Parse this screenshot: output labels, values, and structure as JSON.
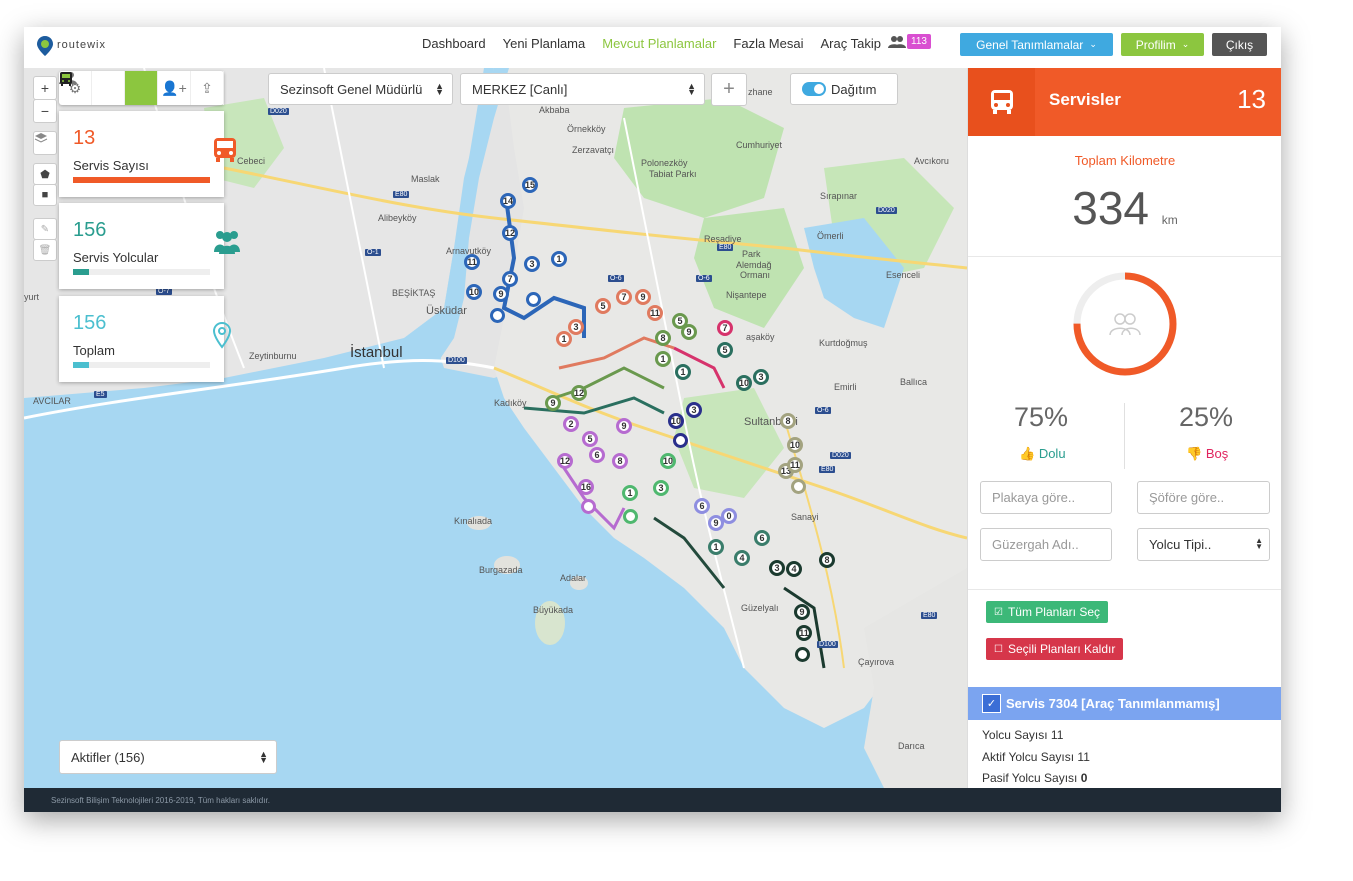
{
  "app": {
    "logo_text": "routewix"
  },
  "nav": {
    "items": [
      "Dashboard",
      "Yeni Planlama",
      "Mevcut Planlamalar",
      "Fazla Mesai",
      "Araç Takip"
    ],
    "active_index": 2,
    "users_badge": "113",
    "genel_label": "Genel Tanımlamalar",
    "profil_label": "Profilim",
    "cikis_label": "Çıkış"
  },
  "colors": {
    "accent": "#f05a28",
    "green": "#8cc63f",
    "teal": "#2a9d8f",
    "cyan": "#4bbfcf",
    "blue_btn": "#3fa9e0",
    "dark_btn": "#555555",
    "badge": "#d94fd1"
  },
  "map": {
    "company_select": "Sezinsoft Genel Müdürlü",
    "location_select": "MERKEZ [Canlı]",
    "toggle_label": "Dağıtım",
    "filter_select": "Aktifler (156)",
    "labels": {
      "maslak": "Maslak",
      "cebeci": "Cebeci",
      "alibeykoy": "Alibeyköy",
      "arnavutkoy": "Arnavutköy",
      "besiktas": "BEŞİKTAŞ",
      "uskudar": "Üsküdar",
      "istanbul": "İstanbul",
      "zeytinburnu": "Zeytinburnu",
      "avcilar": "AVCILAR",
      "yurt": "yurt",
      "akbaba": "Akbaba",
      "omerkoy": "Örnekköy",
      "zerzavatci": "Zerzavatçı",
      "polonezkoy": "Polonezköy",
      "tabiat": "Tabiat Parkı",
      "cumhuriyet": "Cumhuriyet",
      "avcikoru": "Avcıkoru",
      "sirapinar": "Sırapınar",
      "omerli": "Ömerli",
      "resadiye": "Reşadiye",
      "park": "Park",
      "alemdag": "Alemdağ",
      "orman": "Ormanı",
      "esenceli": "Esenceli",
      "nisantepe": "Nişantepe",
      "sakoy": "aşaköy",
      "kurtdogmus": "Kurtdoğmuş",
      "emirli": "Emirli",
      "ballica": "Ballıca",
      "sultanbeyli": "Sultanbeyli",
      "sanayi": "Sanayi",
      "kinaliada": "Kınalıada",
      "burgazada": "Burgazada",
      "adalar": "Adalar",
      "buyukada": "Büyükada",
      "guzelyali": "Güzelyalı",
      "cayirova": "Çayırova",
      "darica": "Darıca",
      "kadikoy": "Kadıköy",
      "zhane": "zhane"
    },
    "road_signs": [
      "D020",
      "E80",
      "O-1",
      "O-7",
      "D100",
      "E5",
      "O-6",
      "D020",
      "O-6",
      "E80",
      "D020",
      "O-6",
      "E80",
      "D100",
      "E80"
    ]
  },
  "cards": [
    {
      "value": "13",
      "label": "Servis Sayısı",
      "color": "#f05a28",
      "fill": 1.0
    },
    {
      "value": "156",
      "label": "Servis Yolcular",
      "color": "#2a9d8f",
      "fill": 0.12
    },
    {
      "value": "156",
      "label": "Toplam",
      "color": "#4bbfcf",
      "fill": 0.12
    }
  ],
  "panel": {
    "title": "Servisler",
    "count": "13",
    "km_label": "Toplam Kilometre",
    "km_value": "334",
    "km_unit": "km",
    "occupancy_fill": 0.75,
    "full_pct": "75%",
    "full_label": "Dolu",
    "empty_pct": "25%",
    "empty_label": "Boş",
    "plate_placeholder": "Plakaya göre..",
    "driver_placeholder": "Şöföre göre..",
    "route_placeholder": "Güzergah Adı..",
    "passenger_type": "Yolcu Tipi..",
    "select_all": "Tüm Planları Seç",
    "remove_selected": "Seçili Planları Kaldır",
    "route_title": "Servis 7304 [Araç Tanımlanmamış]",
    "passenger_count": "Yolcu Sayısı 11",
    "active_passengers_label": "Aktif Yolcu Sayısı",
    "active_passengers": "11",
    "passive_passengers_label": "Pasif Yolcu Sayısı",
    "passive_passengers": "0"
  },
  "footer": {
    "text": "Sezinsoft Bilişim Teknolojileri 2016-2019, Tüm hakları saklıdır."
  }
}
